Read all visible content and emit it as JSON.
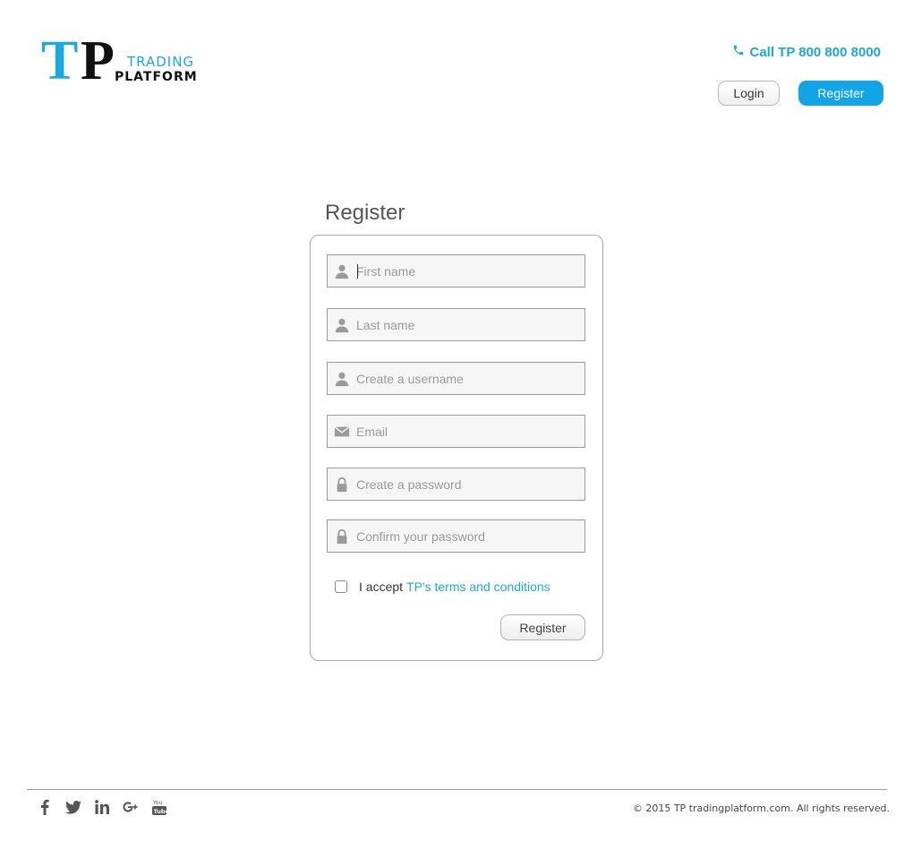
{
  "logo": {
    "letter_t": "T",
    "letter_p": "P",
    "trading": "TRADING",
    "platform": "PLATFORM"
  },
  "header": {
    "call_text": "Call TP 800 800 8000",
    "login_label": "Login",
    "register_label": "Register"
  },
  "form": {
    "title": "Register",
    "fields": [
      {
        "placeholder": "First name",
        "icon": "user-icon"
      },
      {
        "placeholder": "Last name",
        "icon": "user-icon"
      },
      {
        "placeholder": "Create a username",
        "icon": "user-icon"
      },
      {
        "placeholder": "Email",
        "icon": "envelope-icon"
      },
      {
        "placeholder": "Create a password",
        "icon": "lock-icon"
      },
      {
        "placeholder": "Confirm your password",
        "icon": "lock-icon"
      }
    ],
    "accept_prefix": "I accept",
    "terms_link": "TP's terms and conditions",
    "submit_label": "Register"
  },
  "footer": {
    "social": [
      "facebook-icon",
      "twitter-icon",
      "linkedin-icon",
      "google-plus-icon",
      "youtube-icon"
    ],
    "copyright": "© 2015 TP tradingplatform.com. All rights reserved."
  },
  "colors": {
    "accent": "#1aa8e0",
    "primary_button": "#0fa5e6"
  }
}
